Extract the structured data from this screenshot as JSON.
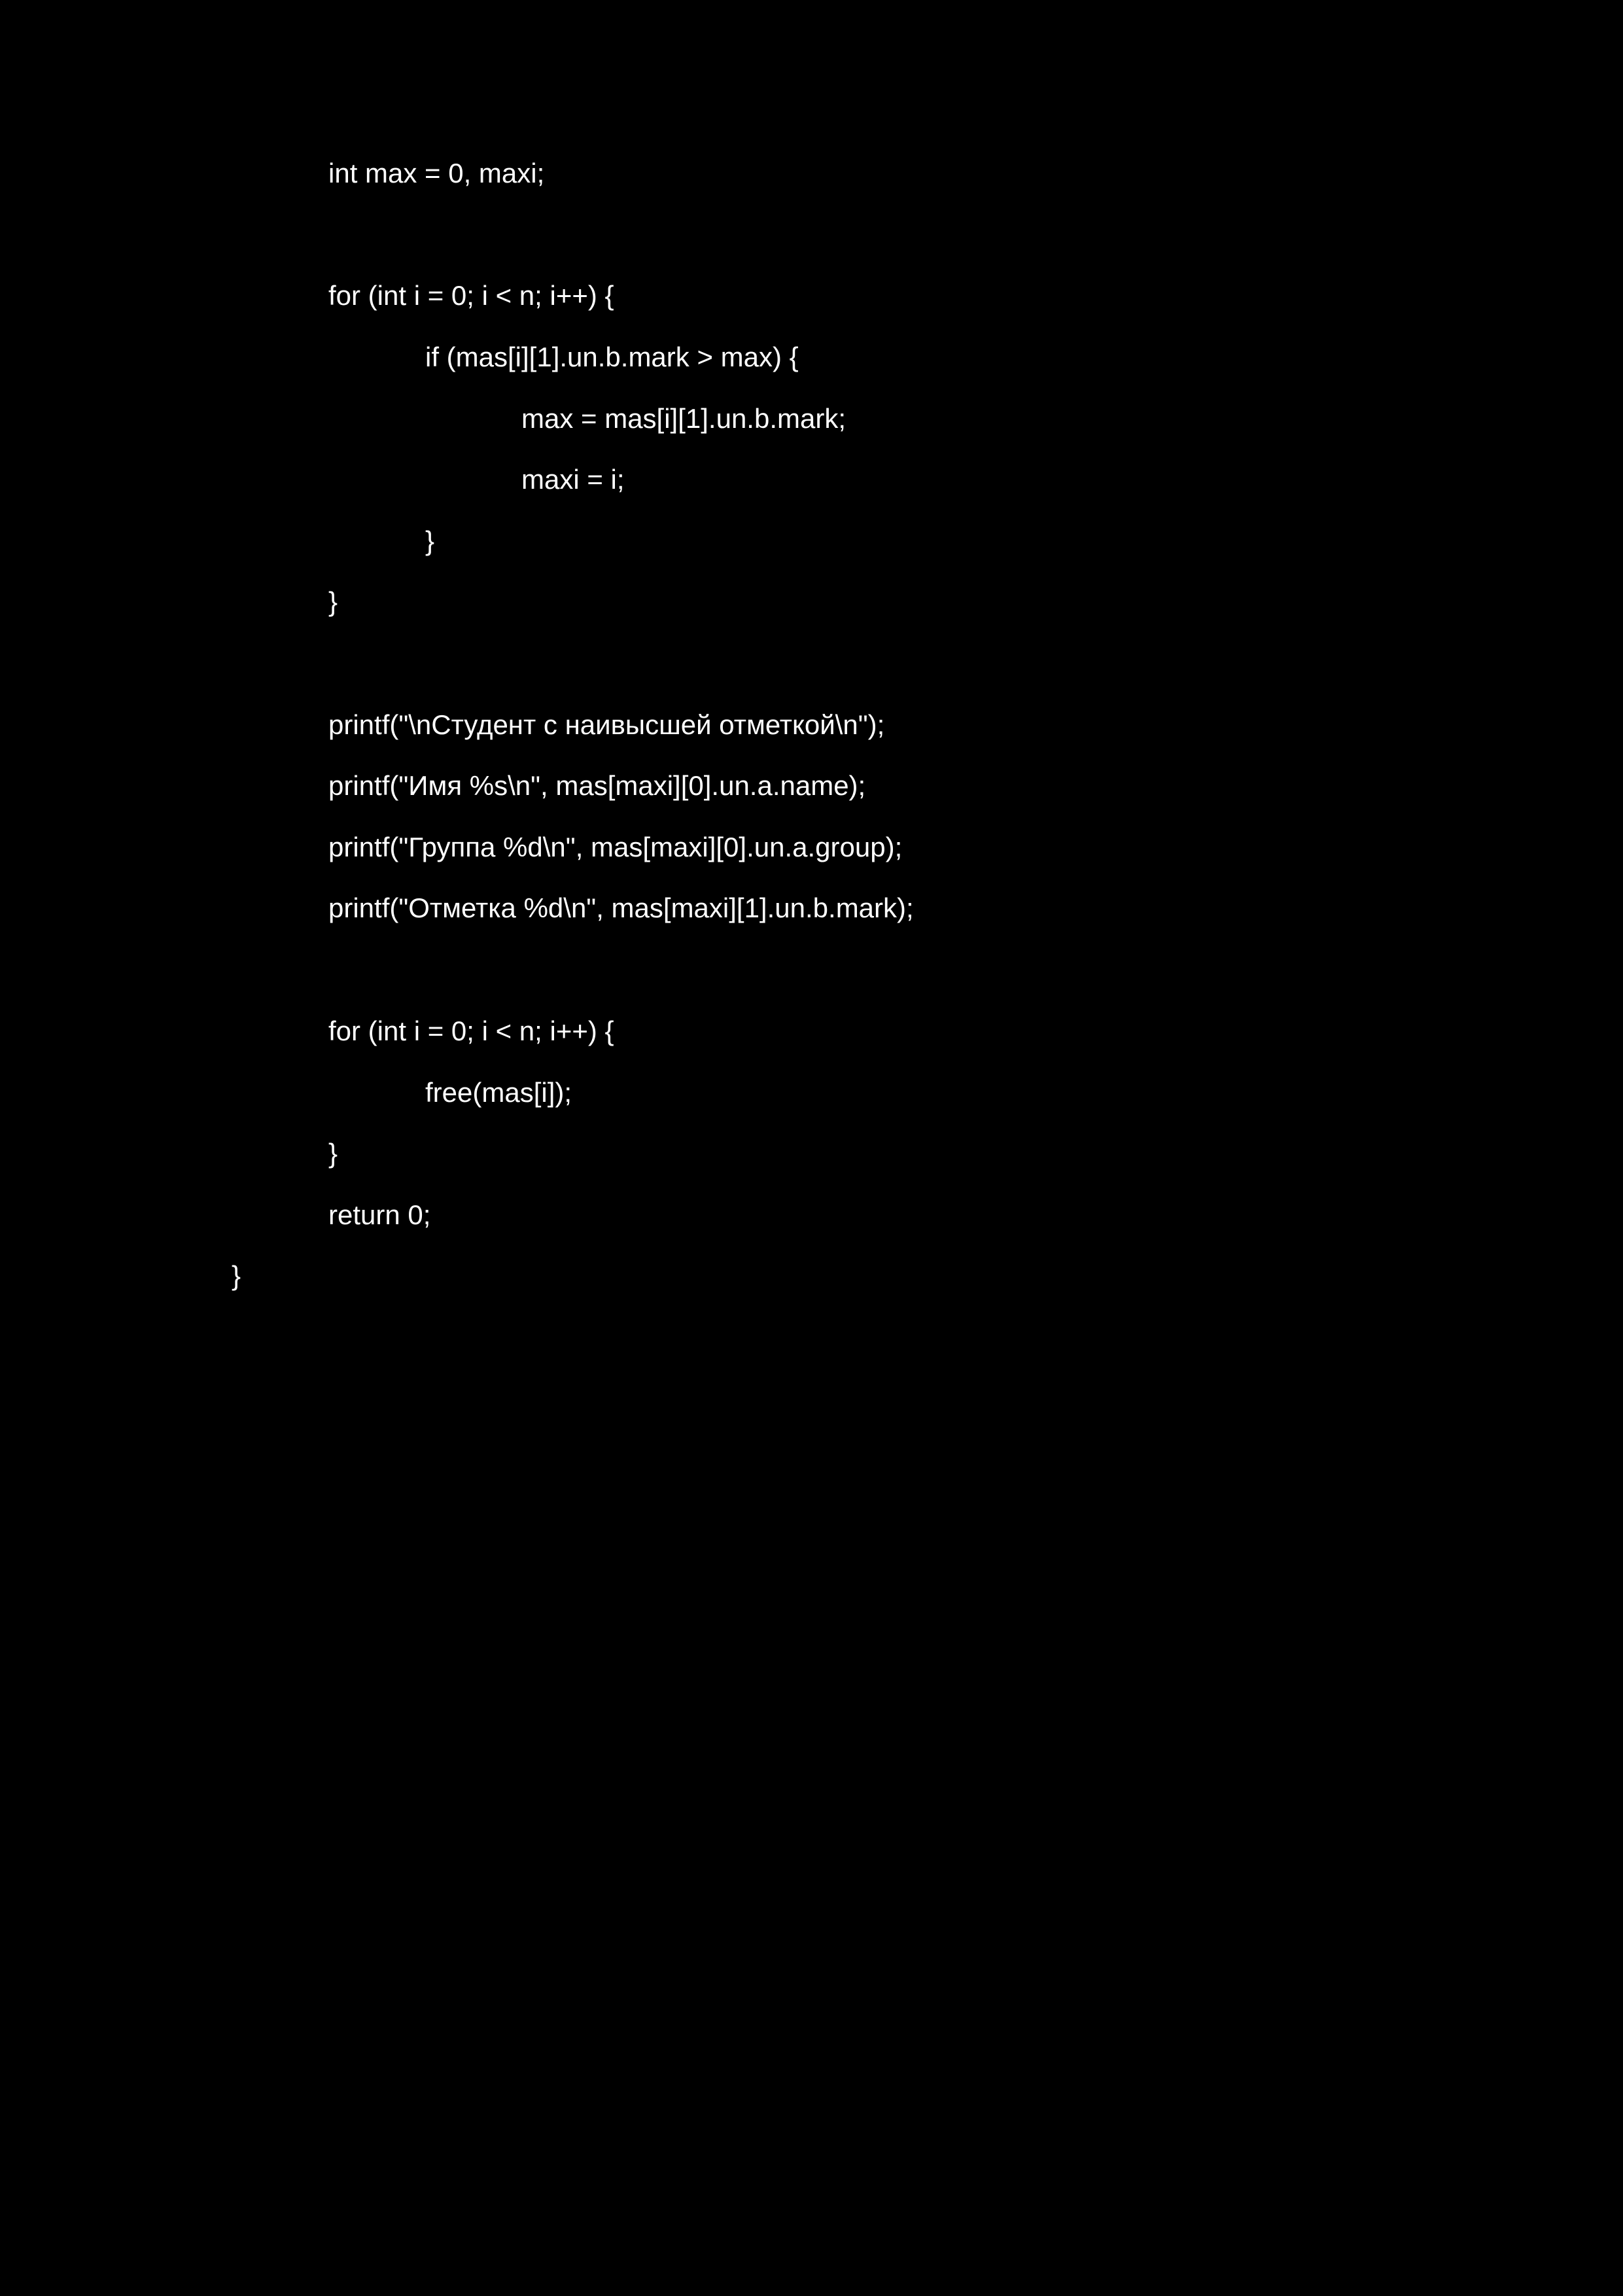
{
  "code": {
    "lines": [
      "int max = 0, maxi;",
      "for (int i = 0; i < n; i++) {",
      "if (mas[i][1].un.b.mark > max) {",
      "max = mas[i][1].un.b.mark;",
      "maxi = i;",
      "}",
      "}",
      "printf(\"\\nСтудент с наивысшей отметкой\\n\");",
      "printf(\"Имя %s\\n\", mas[maxi][0].un.a.name);",
      "printf(\"Группа %d\\n\", mas[maxi][0].un.a.group);",
      "printf(\"Отметка %d\\n\", mas[maxi][1].un.b.mark);",
      "for (int i = 0; i < n; i++) {",
      "free(mas[i]);",
      "}",
      "return 0;",
      "}"
    ]
  }
}
